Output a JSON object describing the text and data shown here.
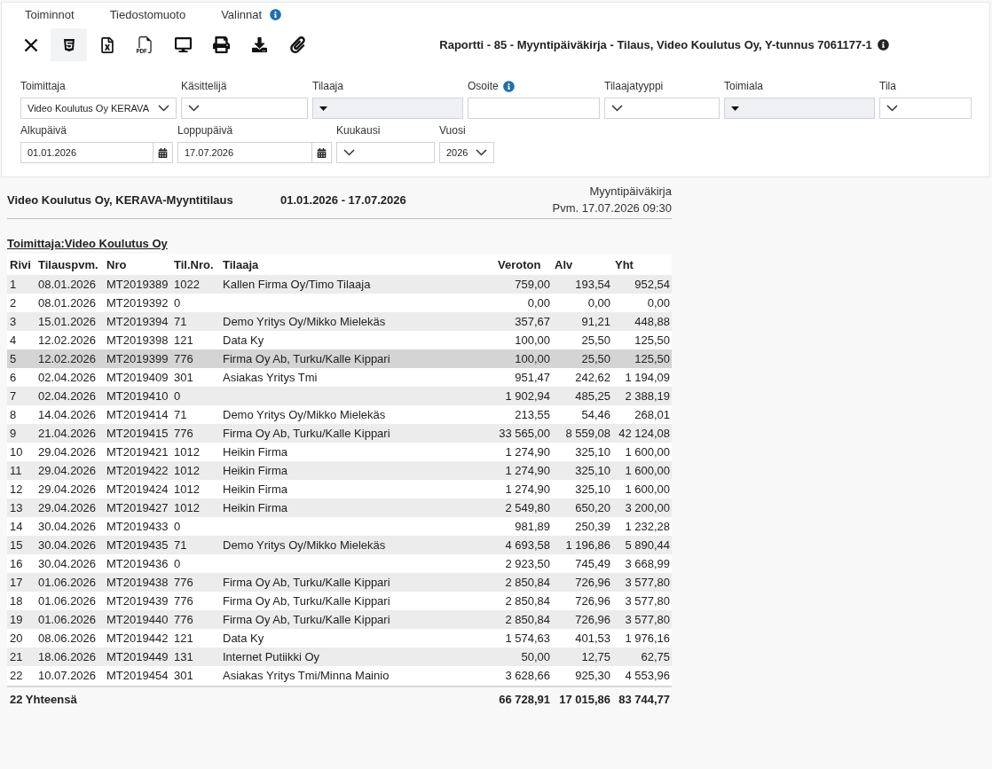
{
  "menu": [
    {
      "label": "Toiminnot"
    },
    {
      "label": "Tiedostomuoto"
    },
    {
      "label": "Valinnat",
      "info": true
    }
  ],
  "toolbar": [
    {
      "kind": "close",
      "selected": false
    },
    {
      "kind": "html",
      "selected": true
    },
    {
      "kind": "excel",
      "selected": false
    },
    {
      "kind": "pdf",
      "selected": false
    },
    {
      "kind": "screen",
      "selected": false
    },
    {
      "kind": "print",
      "selected": false
    },
    {
      "kind": "download",
      "selected": false
    },
    {
      "kind": "attach",
      "selected": false
    }
  ],
  "report_title": {
    "text": "Raportti - 85 - Myyntipäiväkirja - Tilaus, Video Koulutus Oy, Y-tunnus 7061177-1",
    "info": true
  },
  "filters": [
    [
      {
        "label": "Toimittaja",
        "kind": "select",
        "value": "Video Koulutus Oy KERAVA",
        "disabled": false
      },
      {
        "label": "Käsittelijä",
        "kind": "select",
        "disabled": false
      },
      {
        "label": "Tilaaja",
        "kind": "select",
        "disabled": true
      },
      {
        "label": "Osoite",
        "kind": "text",
        "disabled": false,
        "info": true
      },
      {
        "label": "Tilaajatyyppi",
        "kind": "select",
        "disabled": false
      },
      {
        "label": "Toimiala",
        "kind": "select",
        "disabled": true
      },
      {
        "label": "Tila",
        "kind": "select",
        "disabled": false
      }
    ],
    [
      {
        "label": "Alkupäivä",
        "kind": "date",
        "value": "01.01.2026",
        "disabled": false
      },
      {
        "label": "Loppupäivä",
        "kind": "date",
        "value": "17.07.2026",
        "disabled": false
      },
      {
        "label": "Kuukausi",
        "kind": "select",
        "disabled": false
      },
      {
        "label": "Vuosi",
        "kind": "select",
        "value": "2026",
        "disabled": false
      }
    ]
  ],
  "report": {
    "company": "Video Koulutus Oy, KERAVA-Myyntitilaus",
    "period": "01.01.2026 - 17.07.2026",
    "name": "Myyntipäiväkirja",
    "printed": "Pvm. 17.07.2026 09:30"
  },
  "group_heading": "Toimittaja:Video Koulutus Oy",
  "table": {
    "columns": [
      "Rivi",
      "Tilauspvm.",
      "Nro",
      "Til.Nro.",
      "Tilaaja",
      "Veroton",
      "Alv",
      "Yht"
    ],
    "rows": [
      {
        "row": "1",
        "date": "08.01.2026",
        "number": "MT2019389",
        "customer_no": "1022",
        "customer": "Kallen Firma Oy/Timo Tilaaja",
        "net": "759,00",
        "vat": "193,54",
        "total": "952,54",
        "selected": false
      },
      {
        "row": "2",
        "date": "08.01.2026",
        "number": "MT2019392",
        "customer_no": "0",
        "net": "0,00",
        "vat": "0,00",
        "total": "0,00",
        "selected": false
      },
      {
        "row": "3",
        "date": "15.01.2026",
        "number": "MT2019394",
        "customer_no": "71",
        "customer": "Demo Yritys Oy/Mikko Mielekäs",
        "net": "357,67",
        "vat": "91,21",
        "total": "448,88",
        "selected": false
      },
      {
        "row": "4",
        "date": "12.02.2026",
        "number": "MT2019398",
        "customer_no": "121",
        "customer": "Data Ky",
        "net": "100,00",
        "vat": "25,50",
        "total": "125,50",
        "selected": false
      },
      {
        "row": "5",
        "date": "12.02.2026",
        "number": "MT2019399",
        "customer_no": "776",
        "customer": "Firma Oy Ab, Turku/Kalle Kippari",
        "net": "100,00",
        "vat": "25,50",
        "total": "125,50",
        "selected": true
      },
      {
        "row": "6",
        "date": "02.04.2026",
        "number": "MT2019409",
        "customer_no": "301",
        "customer": "Asiakas Yritys Tmi",
        "net": "951,47",
        "vat": "242,62",
        "total": "1 194,09",
        "selected": false
      },
      {
        "row": "7",
        "date": "02.04.2026",
        "number": "MT2019410",
        "customer_no": "0",
        "net": "1 902,94",
        "vat": "485,25",
        "total": "2 388,19",
        "selected": false
      },
      {
        "row": "8",
        "date": "14.04.2026",
        "number": "MT2019414",
        "customer_no": "71",
        "customer": "Demo Yritys Oy/Mikko Mielekäs",
        "net": "213,55",
        "vat": "54,46",
        "total": "268,01",
        "selected": false
      },
      {
        "row": "9",
        "date": "21.04.2026",
        "number": "MT2019415",
        "customer_no": "776",
        "customer": "Firma Oy Ab, Turku/Kalle Kippari",
        "net": "33 565,00",
        "vat": "8 559,08",
        "total": "42 124,08",
        "selected": false
      },
      {
        "row": "10",
        "date": "29.04.2026",
        "number": "MT2019421",
        "customer_no": "1012",
        "customer": "Heikin Firma",
        "net": "1 274,90",
        "vat": "325,10",
        "total": "1 600,00",
        "selected": false
      },
      {
        "row": "11",
        "date": "29.04.2026",
        "number": "MT2019422",
        "customer_no": "1012",
        "customer": "Heikin Firma",
        "net": "1 274,90",
        "vat": "325,10",
        "total": "1 600,00",
        "selected": false
      },
      {
        "row": "12",
        "date": "29.04.2026",
        "number": "MT2019424",
        "customer_no": "1012",
        "customer": "Heikin Firma",
        "net": "1 274,90",
        "vat": "325,10",
        "total": "1 600,00",
        "selected": false
      },
      {
        "row": "13",
        "date": "29.04.2026",
        "number": "MT2019427",
        "customer_no": "1012",
        "customer": "Heikin Firma",
        "net": "2 549,80",
        "vat": "650,20",
        "total": "3 200,00",
        "selected": false
      },
      {
        "row": "14",
        "date": "30.04.2026",
        "number": "MT2019433",
        "customer_no": "0",
        "net": "981,89",
        "vat": "250,39",
        "total": "1 232,28",
        "selected": false
      },
      {
        "row": "15",
        "date": "30.04.2026",
        "number": "MT2019435",
        "customer_no": "71",
        "customer": "Demo Yritys Oy/Mikko Mielekäs",
        "net": "4 693,58",
        "vat": "1 196,86",
        "total": "5 890,44",
        "selected": false
      },
      {
        "row": "16",
        "date": "30.04.2026",
        "number": "MT2019436",
        "customer_no": "0",
        "net": "2 923,50",
        "vat": "745,49",
        "total": "3 668,99",
        "selected": false
      },
      {
        "row": "17",
        "date": "01.06.2026",
        "number": "MT2019438",
        "customer_no": "776",
        "customer": "Firma Oy Ab, Turku/Kalle Kippari",
        "net": "2 850,84",
        "vat": "726,96",
        "total": "3 577,80",
        "selected": false
      },
      {
        "row": "18",
        "date": "01.06.2026",
        "number": "MT2019439",
        "customer_no": "776",
        "customer": "Firma Oy Ab, Turku/Kalle Kippari",
        "net": "2 850,84",
        "vat": "726,96",
        "total": "3 577,80",
        "selected": false
      },
      {
        "row": "19",
        "date": "01.06.2026",
        "number": "MT2019440",
        "customer_no": "776",
        "customer": "Firma Oy Ab, Turku/Kalle Kippari",
        "net": "2 850,84",
        "vat": "726,96",
        "total": "3 577,80",
        "selected": false
      },
      {
        "row": "20",
        "date": "08.06.2026",
        "number": "MT2019442",
        "customer_no": "121",
        "customer": "Data Ky",
        "net": "1 574,63",
        "vat": "401,53",
        "total": "1 976,16",
        "selected": false
      },
      {
        "row": "21",
        "date": "18.06.2026",
        "number": "MT2019449",
        "customer_no": "131",
        "customer": "Internet Putiikki Oy",
        "net": "50,00",
        "vat": "12,75",
        "total": "62,75",
        "selected": false
      },
      {
        "row": "22",
        "date": "10.07.2026",
        "number": "MT2019454",
        "customer_no": "301",
        "customer": "Asiakas Yritys Tmi/Minna Mainio",
        "net": "3 628,66",
        "vat": "925,30",
        "total": "4 553,96",
        "selected": false
      }
    ],
    "totals": {
      "label": "22 Yhteensä",
      "net": "66 728,91",
      "vat": "17 015,86",
      "total": "83 744,77"
    }
  }
}
